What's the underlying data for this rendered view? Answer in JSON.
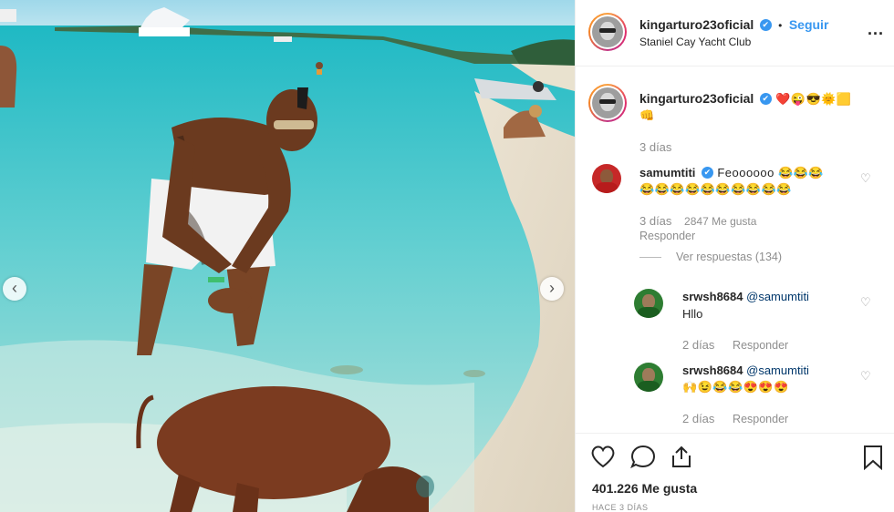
{
  "post": {
    "nav_prev": "‹",
    "nav_next": "›"
  },
  "header": {
    "username": "kingarturo23oficial",
    "verified_mark": "✔",
    "separator": "•",
    "follow_label": "Seguir",
    "location": "Staniel Cay Yacht Club",
    "more_label": "..."
  },
  "caption": {
    "username": "kingarturo23oficial",
    "emojis": "❤️😜😎🌞🟨",
    "emoji_line2": "👊",
    "time": "3 días"
  },
  "comments": [
    {
      "username": "samumtiti",
      "verified": true,
      "text": "Feoooooo 😂😂😂",
      "text_line2": "😂😂😂😂😂😂😂😂😂😂",
      "time": "3 días",
      "likes": "2847 Me gusta",
      "reply_label": "Responder",
      "view_replies": "Ver respuestas (134)",
      "avatar_color": "#c62828"
    }
  ],
  "replies": [
    {
      "username": "srwsh8684",
      "mention": "@samumtiti",
      "text": "Hllo",
      "time": "2 días",
      "reply_label": "Responder",
      "avatar_color": "#2e7d32"
    },
    {
      "username": "srwsh8684",
      "mention": "@samumtiti",
      "text": "🙌😉😂😂😍😍😍",
      "time": "2 días",
      "reply_label": "Responder",
      "avatar_color": "#2e7d32"
    }
  ],
  "actions": {
    "likes": "401.226 Me gusta",
    "posted": "HACE 3 DÍAS"
  },
  "icons": [
    "heart-icon",
    "comment-icon",
    "share-icon",
    "bookmark-icon",
    "verified-icon",
    "more-icon"
  ],
  "colors": {
    "accent": "#3897f0",
    "text": "#262626",
    "muted": "#8e8e8e",
    "like_red": "#ed4956"
  }
}
